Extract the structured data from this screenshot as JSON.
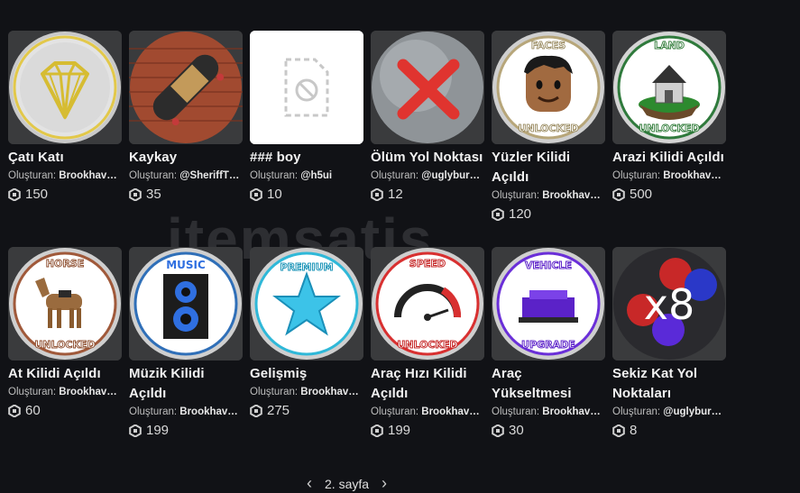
{
  "items": [
    {
      "name": "Çatı Katı",
      "creator_prefix": "Oluşturan:",
      "creator": "Brookhav…",
      "price": "150",
      "icon": "diamond-icon"
    },
    {
      "name": "Kaykay",
      "creator_prefix": "Oluşturan:",
      "creator": "@SheriffT…",
      "price": "35",
      "icon": "skateboard-icon"
    },
    {
      "name": "### boy",
      "creator_prefix": "Oluşturan:",
      "creator": "@h5ui",
      "price": "10",
      "icon": "blocked-image-icon"
    },
    {
      "name": "Ölüm Yol Noktası",
      "creator_prefix": "Oluşturan:",
      "creator": "@uglybur…",
      "price": "12",
      "icon": "red-x-icon"
    },
    {
      "name": "Yüzler Kilidi Açıldı",
      "creator_prefix": "Oluşturan:",
      "creator": "Brookhav…",
      "price": "120",
      "icon": "faces-unlocked-icon"
    },
    {
      "name": "Arazi Kilidi Açıldı",
      "creator_prefix": "Oluşturan:",
      "creator": "Brookhav…",
      "price": "500",
      "icon": "land-unlocked-icon"
    },
    {
      "name": "At Kilidi Açıldı",
      "creator_prefix": "Oluşturan:",
      "creator": "Brookhav…",
      "price": "60",
      "icon": "horse-unlocked-icon"
    },
    {
      "name": "Müzik Kilidi Açıldı",
      "creator_prefix": "Oluşturan:",
      "creator": "Brookhav…",
      "price": "199",
      "icon": "music-speaker-icon"
    },
    {
      "name": "Gelişmiş",
      "creator_prefix": "Oluşturan:",
      "creator": "Brookhav…",
      "price": "275",
      "icon": "premium-star-icon"
    },
    {
      "name": "Araç Hızı Kilidi Açıldı",
      "creator_prefix": "Oluşturan:",
      "creator": "Brookhav…",
      "price": "199",
      "icon": "speedometer-icon"
    },
    {
      "name": "Araç Yükseltmesi",
      "creator_prefix": "Oluşturan:",
      "creator": "Brookhav…",
      "price": "30",
      "icon": "vehicle-upgrade-icon"
    },
    {
      "name": "Sekiz Kat Yol Noktaları",
      "creator_prefix": "Oluşturan:",
      "creator": "@uglybur…",
      "price": "8",
      "icon": "x8-waypoints-icon"
    }
  ],
  "badge_texts": {
    "faces_top": "FACES",
    "faces_bottom": "UNLOCKED",
    "land_top": "LAND",
    "land_bottom": "UNLOCKED",
    "horse_top": "HORSE",
    "horse_bottom": "UNLOCKED",
    "music_top": "MUSIC",
    "premium_top": "PREMIUM",
    "speed_top": "SPEED",
    "speed_bottom": "UNLOCKED",
    "vehicle_top": "VEHICLE",
    "vehicle_bottom": "UPGRADE",
    "x8": "x8"
  },
  "watermark": "itemsatis",
  "pager": {
    "prev": "‹",
    "label": "2. sayfa",
    "next": "›"
  },
  "colors": {
    "background": "#111216",
    "card": "#393b3d"
  }
}
